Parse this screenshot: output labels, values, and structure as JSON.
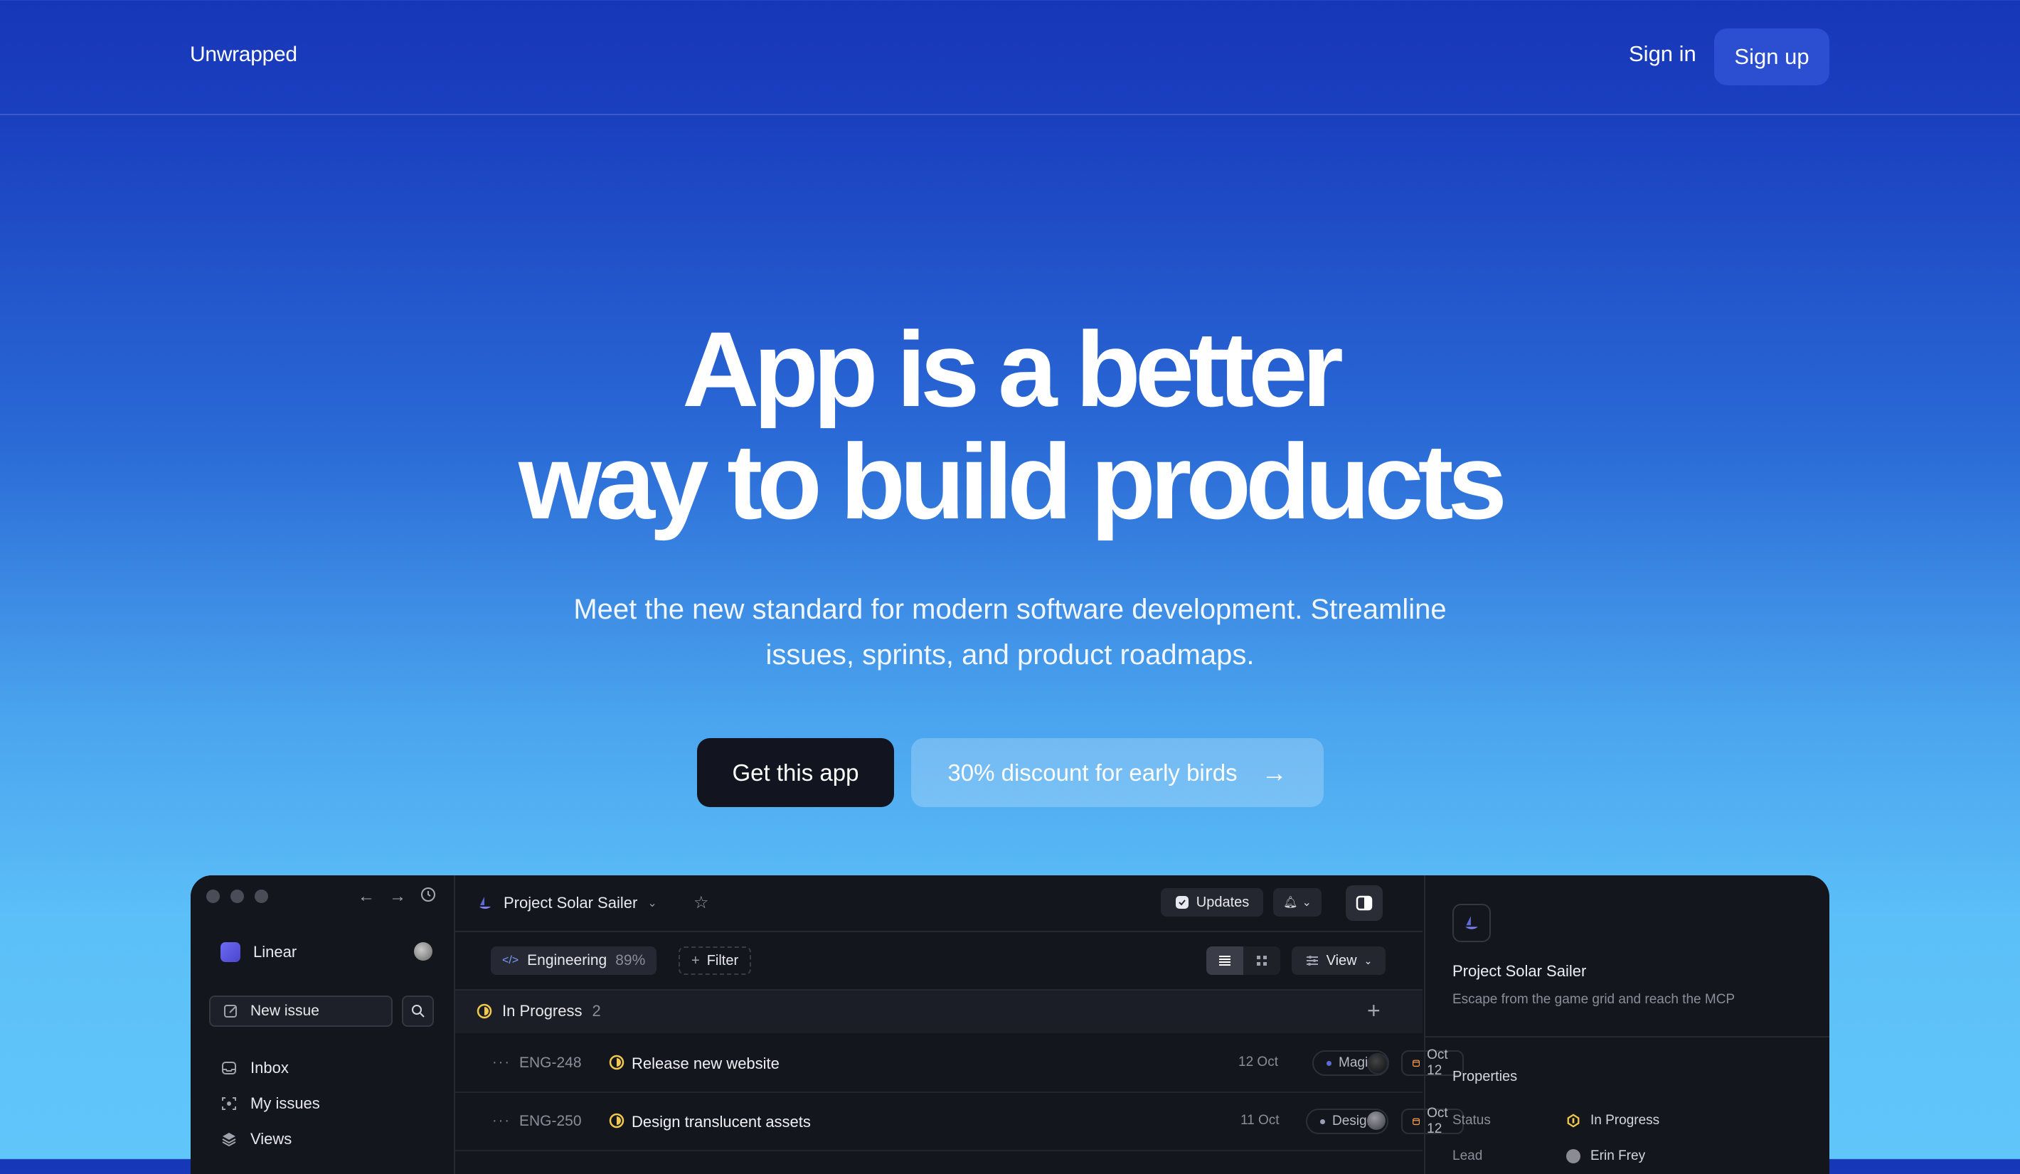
{
  "nav": {
    "brand": "Unwrapped",
    "sign_in": "Sign in",
    "sign_up": "Sign up"
  },
  "hero": {
    "title_line1": "App is a better",
    "title_line2": "way to build products",
    "subtitle_line1": "Meet the new standard for modern software development. Streamline",
    "subtitle_line2": "issues, sprints, and product roadmaps.",
    "cta_primary": "Get this app",
    "cta_secondary": "30% discount for early birds",
    "cta_secondary_icon": "arrow-right-icon"
  },
  "app": {
    "sidebar": {
      "workspace": "Linear",
      "new_issue": "New issue",
      "items": [
        {
          "label": "Inbox",
          "icon": "inbox-icon"
        },
        {
          "label": "My issues",
          "icon": "my-issues-icon"
        },
        {
          "label": "Views",
          "icon": "layers-icon"
        }
      ]
    },
    "header": {
      "project": "Project Solar Sailer",
      "updates": "Updates"
    },
    "filters": {
      "team": "Engineering",
      "team_progress": "89%",
      "filter": "Filter",
      "view": "View"
    },
    "group": {
      "label": "In Progress",
      "count": "2"
    },
    "issues": [
      {
        "id": "ENG-248",
        "title": "Release new website",
        "label": "Magic",
        "label_color": "#5e6ad2",
        "due": "Oct 12",
        "date": "12 Oct"
      },
      {
        "id": "ENG-250",
        "title": "Design translucent assets",
        "label": "Design",
        "label_color": "#9aa0b4",
        "due": "Oct 12",
        "date": "11 Oct"
      }
    ],
    "detail": {
      "title": "Project Solar Sailer",
      "description": "Escape from the game grid and reach the MCP",
      "properties_heading": "Properties",
      "status_key": "Status",
      "status_value": "In Progress",
      "lead_key": "Lead",
      "lead_value": "Erin Frey"
    }
  },
  "colors": {
    "in_progress": "#f2c94c",
    "due_chip": "#f2994a",
    "cta_dark": "#121520"
  }
}
